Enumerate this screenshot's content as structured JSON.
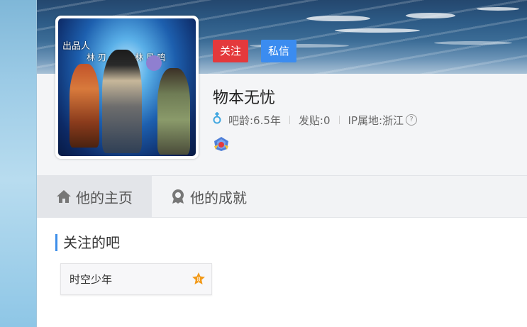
{
  "profile": {
    "username": "物本无忧",
    "follow_label": "关注",
    "message_label": "私信",
    "age": "吧龄:6.5年",
    "posts": "发贴:0",
    "ip_location": "IP属地:浙江",
    "help_glyph": "?",
    "gender_icon": "male-icon",
    "avatar_text": [
      "出品人",
      "林 刃",
      "林 目 鸣"
    ],
    "badge_icon": "member-badge-icon"
  },
  "tabs": [
    {
      "label": "他的主页",
      "icon": "home-icon",
      "active": true
    },
    {
      "label": "他的成就",
      "icon": "achievement-icon",
      "active": false
    }
  ],
  "followed": {
    "title": "关注的吧",
    "forums": [
      {
        "name": "时空少年",
        "level_icon": "level-star-icon",
        "level_glyph": "8"
      }
    ]
  },
  "colors": {
    "follow": "#e4393c",
    "message": "#3b8cf0",
    "accent": "#3d8ee9",
    "gender": "#41a7e0",
    "level_star": "#f29a1a"
  }
}
